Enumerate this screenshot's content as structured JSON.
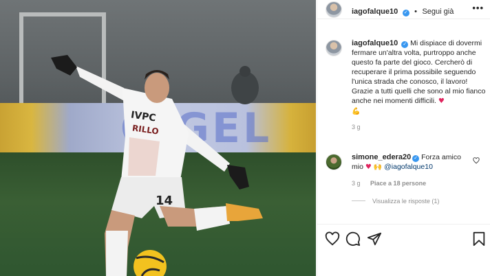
{
  "post": {
    "photo": {
      "sponsor_text": "O GEL",
      "shirt_sponsor_1": "IVPC",
      "shirt_sponsor_2": "RILLO",
      "shirt_number": "14"
    },
    "header": {
      "username": "iagofalque10",
      "verified": true,
      "follow_label": "Segui già",
      "separator": "•",
      "more_icon": "more-options-icon"
    },
    "caption": {
      "username": "iagofalque10",
      "text": "Mi dispiace di dovermi fermare un'altra volta, purtroppo anche questo fa parte del gioco. Cercherò di recuperare il prima possibile seguendo l'unica strada che conosco, il lavoro!",
      "text2": "Grazie a tutti quelli che sono al mio fianco anche nei momenti difficili.",
      "emoji_heart": "♥",
      "emoji_muscle": "💪",
      "time": "3 g"
    },
    "comment": {
      "username": "simone_edera20",
      "verified": true,
      "text": "Forza amico mio",
      "emoji_heart": "♥",
      "emoji_hands": "🙌",
      "mention": "@iagofalque10",
      "time": "3 g",
      "likes": "Piace a 18 persone",
      "view_replies": "Visualizza le risposte (1)"
    },
    "actions": {
      "like_icon": "heart-icon",
      "comment_icon": "comment-icon",
      "share_icon": "send-icon",
      "save_icon": "bookmark-icon"
    }
  },
  "colors": {
    "verified": "#3897f0",
    "text": "#262626",
    "secondary": "#8e8e8e",
    "heart": "#e0245e",
    "mention": "#00376b"
  }
}
